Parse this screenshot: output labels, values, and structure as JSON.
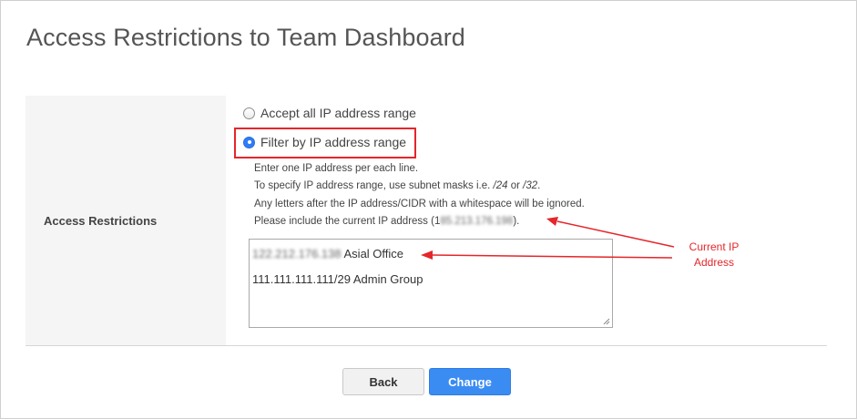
{
  "page": {
    "title": "Access Restrictions to Team Dashboard"
  },
  "form": {
    "row_label": "Access Restrictions",
    "options": [
      {
        "label": "Accept all IP address range",
        "selected": false
      },
      {
        "label": "Filter by IP address range",
        "selected": true
      }
    ],
    "help": {
      "line1": "Enter one IP address per each line.",
      "line2_prefix": "To specify IP address range, use subnet masks i.e. ",
      "line2_mask1": "/24",
      "line2_or": " or ",
      "line2_mask2": "/32",
      "line2_suffix": ".",
      "line3": "Any letters after the IP address/CIDR with a whitespace will be ignored.",
      "line4_prefix": "Please include the current IP address (",
      "line4_ip_visible": "1",
      "line4_ip_blurred": "85.213.176.198",
      "line4_suffix": ")."
    },
    "ip_list": {
      "line1_ip_blurred": "122.212.176.138",
      "line1_text": " Asial Office",
      "line2": "111.111.111.111/29 Admin Group"
    }
  },
  "annotation": {
    "line1": "Current IP",
    "line2": "Address"
  },
  "buttons": {
    "back": "Back",
    "change": "Change"
  },
  "colors": {
    "accent": "#3b8cf2",
    "annotation": "#e5262a",
    "label_bg": "#f5f5f5"
  }
}
